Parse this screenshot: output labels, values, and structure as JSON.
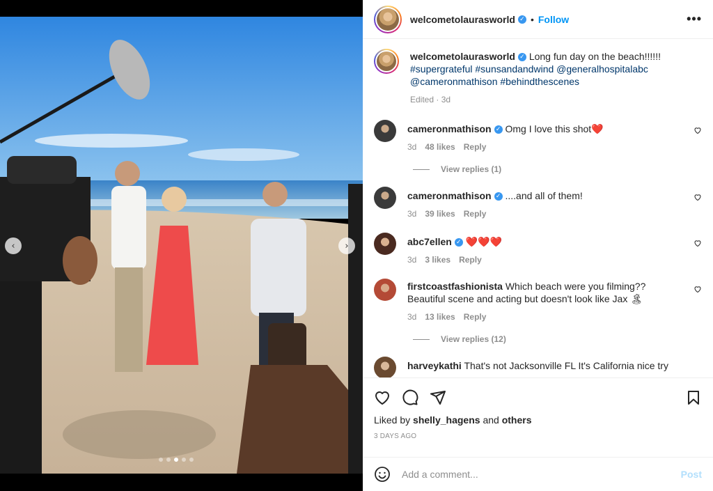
{
  "header": {
    "username": "welcometolaurasworld",
    "separator": "•",
    "follow_label": "Follow",
    "more_icon": "•••"
  },
  "caption": {
    "username": "welcometolaurasworld",
    "text": "Long fun day on the beach!!!!!!",
    "tags": "#supergrateful #sunsandandwind @generalhospitalabc @cameronmathison #behindthescenes",
    "meta": "Edited · 3d"
  },
  "comments": [
    {
      "username": "cameronmathison",
      "text": "Omg I love this shot",
      "emoji": "❤️",
      "age": "3d",
      "likes": "48 likes",
      "reply": "Reply",
      "view_replies": "View replies (1)"
    },
    {
      "username": "cameronmathison",
      "text": "....and all of them!",
      "age": "3d",
      "likes": "39 likes",
      "reply": "Reply"
    },
    {
      "username": "abc7ellen",
      "emoji": "❤️❤️❤️",
      "age": "3d",
      "likes": "3 likes",
      "reply": "Reply"
    },
    {
      "username": "firstcoastfashionista",
      "text": "Which beach were you filming?? Beautiful scene and acting but doesn't look like Jax",
      "emoji": "🏝",
      "age": "3d",
      "likes": "13 likes",
      "reply": "Reply",
      "view_replies": "View replies (12)"
    },
    {
      "username": "harveykathi",
      "text": "That's not Jacksonville FL It's California nice try"
    }
  ],
  "actions": {
    "liked_prefix": "Liked by",
    "liked_user": "shelly_hagens",
    "liked_and": "and",
    "liked_others": "others",
    "date": "3 DAYS AGO"
  },
  "add_comment": {
    "placeholder": "Add a comment...",
    "post_label": "Post"
  },
  "carousel": {
    "prev": "‹",
    "next": "›",
    "slide_count": 5,
    "active_slide": 3
  },
  "colors": {
    "accent": "#0095f6",
    "verified": "#3897f0",
    "post_disabled": "#b2dffc"
  }
}
